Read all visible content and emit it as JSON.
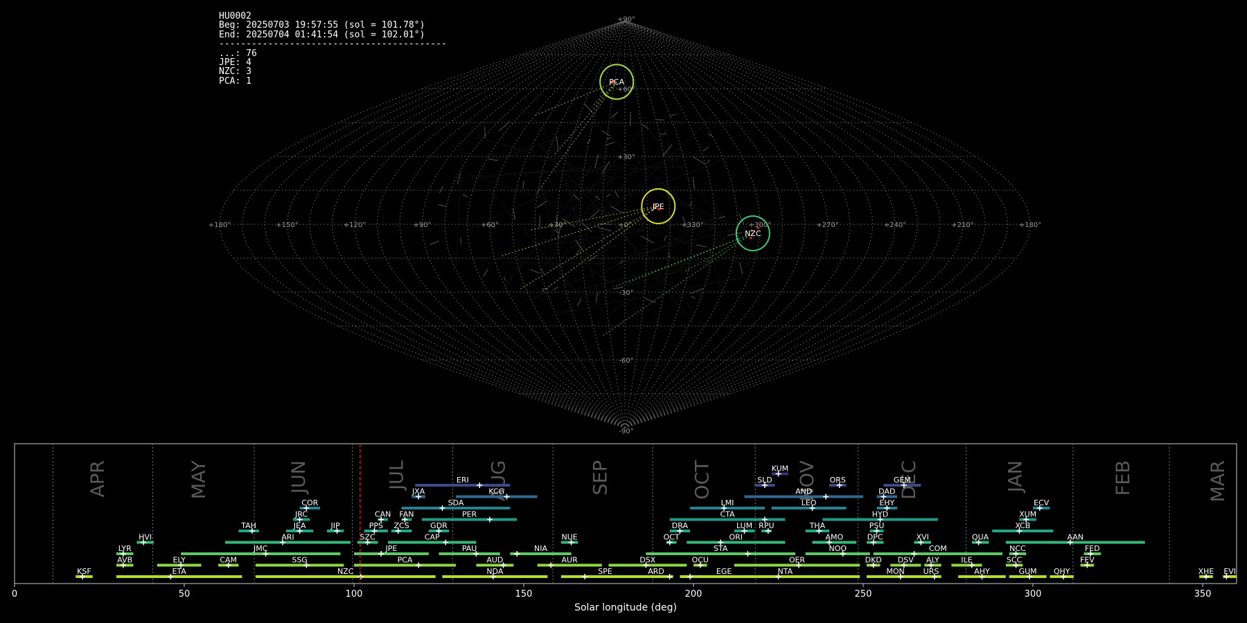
{
  "info": {
    "id": "HU0002",
    "beg": "Beg: 20250703 19:57:55 (sol = 101.78°)",
    "end": "End: 20250704 01:41:54 (sol = 102.01°)",
    "separator": "------------------------------------------",
    "counts": [
      "...: 76",
      "JPE: 4",
      "NZC: 3",
      "PCA: 1"
    ]
  },
  "colors": {
    "background": "#000000",
    "grid": "#888888",
    "marker": "#ff2020",
    "jpe_circle": "#d8e020",
    "pca_circle": "#a8dc40",
    "nzc_circle": "#40c878",
    "current_line": "#ff0000"
  },
  "sky_map": {
    "projection": "sinusoidal",
    "lon_labels": [
      "+180°",
      "+150°",
      "+120°",
      "+90°",
      "+60°",
      "+30°",
      "+0°",
      "+330°",
      "+300°",
      "+270°",
      "+240°",
      "+210°",
      "+180°"
    ],
    "lat_labels": [
      "+90°",
      "+60°",
      "+30°",
      "-30°",
      "-60°",
      "-90°"
    ],
    "radiants": [
      {
        "code": "PCA",
        "lon": 8,
        "lat": 63,
        "color": "#a8dc40"
      },
      {
        "code": "JPE",
        "lon": 345,
        "lat": 8,
        "color": "#d8e020"
      },
      {
        "code": "NZC",
        "lon": 303,
        "lat": -4,
        "color": "#40c878"
      }
    ]
  },
  "chart_data": {
    "type": "timeline",
    "xlabel": "Solar longitude (deg)",
    "xlim": [
      0,
      360
    ],
    "xticks": [
      0,
      50,
      100,
      150,
      200,
      250,
      300,
      350
    ],
    "current_sol": 101.78,
    "months": [
      {
        "name": "APR",
        "sol": 24.5
      },
      {
        "name": "MAY",
        "sol": 54.3
      },
      {
        "name": "JUN",
        "sol": 83.7
      },
      {
        "name": "JUL",
        "sol": 112.5
      },
      {
        "name": "AUG",
        "sol": 142.5
      },
      {
        "name": "SEP",
        "sol": 172.5
      },
      {
        "name": "OCT",
        "sol": 202.5
      },
      {
        "name": "NOV",
        "sol": 233.5
      },
      {
        "name": "DEC",
        "sol": 263.5
      },
      {
        "name": "JAN",
        "sol": 294.8
      },
      {
        "name": "FEB",
        "sol": 326.5
      },
      {
        "name": "MAR",
        "sol": 354.5
      }
    ],
    "month_boundaries": [
      11.3,
      40.7,
      70.6,
      99.5,
      129.1,
      158.6,
      188.0,
      218.2,
      248.5,
      280.3,
      311.8,
      340.2
    ],
    "showers": [
      {
        "code": "KSF",
        "row": 0,
        "start": 18,
        "end": 23,
        "peak": 20
      },
      {
        "code": "ETA",
        "row": 0,
        "start": 30,
        "end": 67,
        "peak": 46
      },
      {
        "code": "NZC",
        "row": 0,
        "start": 71,
        "end": 124,
        "peak": 102
      },
      {
        "code": "NDA",
        "row": 0,
        "start": 126,
        "end": 157,
        "peak": 141
      },
      {
        "code": "SPE",
        "row": 0,
        "start": 161,
        "end": 187,
        "peak": 168
      },
      {
        "code": "ARD",
        "row": 0,
        "start": 184,
        "end": 194,
        "peak": 193
      },
      {
        "code": "EGE",
        "row": 0,
        "start": 196,
        "end": 222,
        "peak": 199
      },
      {
        "code": "NTA",
        "row": 0,
        "start": 205,
        "end": 249,
        "peak": 225
      },
      {
        "code": "MON",
        "row": 0,
        "start": 251,
        "end": 268,
        "peak": 261
      },
      {
        "code": "URS",
        "row": 0,
        "start": 267,
        "end": 273,
        "peak": 271
      },
      {
        "code": "AHY",
        "row": 0,
        "start": 278,
        "end": 292,
        "peak": 285
      },
      {
        "code": "GUM",
        "row": 0,
        "start": 293,
        "end": 304,
        "peak": 299
      },
      {
        "code": "QHY",
        "row": 0,
        "start": 305,
        "end": 312,
        "peak": 309
      },
      {
        "code": "XHE",
        "row": 0,
        "start": 349,
        "end": 353,
        "peak": 351
      },
      {
        "code": "EVI",
        "row": 0,
        "start": 356,
        "end": 360,
        "peak": 357
      },
      {
        "code": "AVB",
        "row": 1,
        "start": 30,
        "end": 35,
        "peak": 32
      },
      {
        "code": "ELY",
        "row": 1,
        "start": 42,
        "end": 55,
        "peak": 49
      },
      {
        "code": "CAM",
        "row": 1,
        "start": 60,
        "end": 66,
        "peak": 63
      },
      {
        "code": "SSG",
        "row": 1,
        "start": 71,
        "end": 97,
        "peak": 86
      },
      {
        "code": "PCA",
        "row": 1,
        "start": 100,
        "end": 130,
        "peak": 119
      },
      {
        "code": "AUD",
        "row": 1,
        "start": 136,
        "end": 147,
        "peak": 144
      },
      {
        "code": "AUR",
        "row": 1,
        "start": 154,
        "end": 173,
        "peak": 158
      },
      {
        "code": "DSX",
        "row": 1,
        "start": 175,
        "end": 198,
        "peak": 186
      },
      {
        "code": "OCU",
        "row": 1,
        "start": 200,
        "end": 204,
        "peak": 202
      },
      {
        "code": "OER",
        "row": 1,
        "start": 212,
        "end": 249,
        "peak": 231
      },
      {
        "code": "DKD",
        "row": 1,
        "start": 251,
        "end": 255,
        "peak": 253
      },
      {
        "code": "DSV",
        "row": 1,
        "start": 258,
        "end": 267,
        "peak": 262
      },
      {
        "code": "ALY",
        "row": 1,
        "start": 268,
        "end": 273,
        "peak": 270
      },
      {
        "code": "ILE",
        "row": 1,
        "start": 276,
        "end": 285,
        "peak": 282
      },
      {
        "code": "SCC",
        "row": 1,
        "start": 292,
        "end": 297,
        "peak": 295
      },
      {
        "code": "FEV",
        "row": 1,
        "start": 314,
        "end": 318,
        "peak": 316
      },
      {
        "code": "LYR",
        "row": 2,
        "start": 30,
        "end": 35,
        "peak": 32
      },
      {
        "code": "JMC",
        "row": 2,
        "start": 49,
        "end": 96,
        "peak": 74
      },
      {
        "code": "JPE",
        "row": 2,
        "start": 100,
        "end": 122,
        "peak": 108
      },
      {
        "code": "PAU",
        "row": 2,
        "start": 125,
        "end": 143,
        "peak": 136
      },
      {
        "code": "NIA",
        "row": 2,
        "start": 146,
        "end": 164,
        "peak": 148
      },
      {
        "code": "STA",
        "row": 2,
        "start": 186,
        "end": 230,
        "peak": 216
      },
      {
        "code": "NOO",
        "row": 2,
        "start": 233,
        "end": 252,
        "peak": 244
      },
      {
        "code": "COM",
        "row": 2,
        "start": 253,
        "end": 291,
        "peak": 265
      },
      {
        "code": "NCC",
        "row": 2,
        "start": 293,
        "end": 298,
        "peak": 295
      },
      {
        "code": "FED",
        "row": 2,
        "start": 315,
        "end": 320,
        "peak": 317
      },
      {
        "code": "HVI",
        "row": 3,
        "start": 36,
        "end": 41,
        "peak": 38
      },
      {
        "code": "ARI",
        "row": 3,
        "start": 62,
        "end": 99,
        "peak": 79
      },
      {
        "code": "SZC",
        "row": 3,
        "start": 101,
        "end": 107,
        "peak": 104
      },
      {
        "code": "CAP",
        "row": 3,
        "start": 110,
        "end": 136,
        "peak": 127
      },
      {
        "code": "NUE",
        "row": 3,
        "start": 161,
        "end": 166,
        "peak": 164
      },
      {
        "code": "OCT",
        "row": 3,
        "start": 192,
        "end": 195,
        "peak": 193
      },
      {
        "code": "ORI",
        "row": 3,
        "start": 198,
        "end": 227,
        "peak": 208
      },
      {
        "code": "AMO",
        "row": 3,
        "start": 235,
        "end": 248,
        "peak": 240
      },
      {
        "code": "DPC",
        "row": 3,
        "start": 251,
        "end": 256,
        "peak": 253
      },
      {
        "code": "XVI",
        "row": 3,
        "start": 265,
        "end": 270,
        "peak": 267
      },
      {
        "code": "QUA",
        "row": 3,
        "start": 282,
        "end": 287,
        "peak": 284
      },
      {
        "code": "AAN",
        "row": 3,
        "start": 292,
        "end": 333,
        "peak": 311
      },
      {
        "code": "TAH",
        "row": 4,
        "start": 66,
        "end": 72,
        "peak": 70
      },
      {
        "code": "JEA",
        "row": 4,
        "start": 80,
        "end": 88,
        "peak": 84
      },
      {
        "code": "JIP",
        "row": 4,
        "start": 92,
        "end": 97,
        "peak": 95
      },
      {
        "code": "PPS",
        "row": 4,
        "start": 103,
        "end": 110,
        "peak": 106
      },
      {
        "code": "ZCS",
        "row": 4,
        "start": 111,
        "end": 117,
        "peak": 113
      },
      {
        "code": "GDR",
        "row": 4,
        "start": 122,
        "end": 128,
        "peak": 125
      },
      {
        "code": "DRA",
        "row": 4,
        "start": 193,
        "end": 199,
        "peak": 196
      },
      {
        "code": "LUM",
        "row": 4,
        "start": 212,
        "end": 218,
        "peak": 215
      },
      {
        "code": "RPU",
        "row": 4,
        "start": 220,
        "end": 223,
        "peak": 222
      },
      {
        "code": "THA",
        "row": 4,
        "start": 233,
        "end": 240,
        "peak": 237
      },
      {
        "code": "PSU",
        "row": 4,
        "start": 252,
        "end": 256,
        "peak": 254
      },
      {
        "code": "XCB",
        "row": 4,
        "start": 288,
        "end": 306,
        "peak": 296
      },
      {
        "code": "JRC",
        "row": 5,
        "start": 82,
        "end": 87,
        "peak": 84
      },
      {
        "code": "CAN",
        "row": 5,
        "start": 107,
        "end": 110,
        "peak": 108
      },
      {
        "code": "FAN",
        "row": 5,
        "start": 114,
        "end": 117,
        "peak": 115
      },
      {
        "code": "PER",
        "row": 5,
        "start": 120,
        "end": 148,
        "peak": 140
      },
      {
        "code": "CTA",
        "row": 5,
        "start": 193,
        "end": 227,
        "peak": 221
      },
      {
        "code": "HYD",
        "row": 5,
        "start": 238,
        "end": 272,
        "peak": 255
      },
      {
        "code": "XUM",
        "row": 5,
        "start": 296,
        "end": 301,
        "peak": 298
      },
      {
        "code": "COR",
        "row": 6,
        "start": 84,
        "end": 90,
        "peak": 86
      },
      {
        "code": "SDA",
        "row": 6,
        "start": 114,
        "end": 146,
        "peak": 126
      },
      {
        "code": "LMI",
        "row": 6,
        "start": 199,
        "end": 221,
        "peak": 209
      },
      {
        "code": "LEO",
        "row": 6,
        "start": 223,
        "end": 245,
        "peak": 235
      },
      {
        "code": "EHY",
        "row": 6,
        "start": 254,
        "end": 260,
        "peak": 257
      },
      {
        "code": "ECV",
        "row": 6,
        "start": 300,
        "end": 305,
        "peak": 302
      },
      {
        "code": "JXA",
        "row": 7,
        "start": 117,
        "end": 121,
        "peak": 119
      },
      {
        "code": "KCG",
        "row": 7,
        "start": 130,
        "end": 154,
        "peak": 145
      },
      {
        "code": "AND",
        "row": 7,
        "start": 215,
        "end": 250,
        "peak": 239
      },
      {
        "code": "DAD",
        "row": 7,
        "start": 254,
        "end": 260,
        "peak": 256
      },
      {
        "code": "ERI",
        "row": 8,
        "start": 118,
        "end": 146,
        "peak": 137
      },
      {
        "code": "SLD",
        "row": 8,
        "start": 218,
        "end": 224,
        "peak": 221
      },
      {
        "code": "ORS",
        "row": 8,
        "start": 240,
        "end": 245,
        "peak": 243
      },
      {
        "code": "GEM",
        "row": 8,
        "start": 256,
        "end": 267,
        "peak": 262
      },
      {
        "code": "KUM",
        "row": 9,
        "start": 223,
        "end": 228,
        "peak": 225
      }
    ]
  }
}
